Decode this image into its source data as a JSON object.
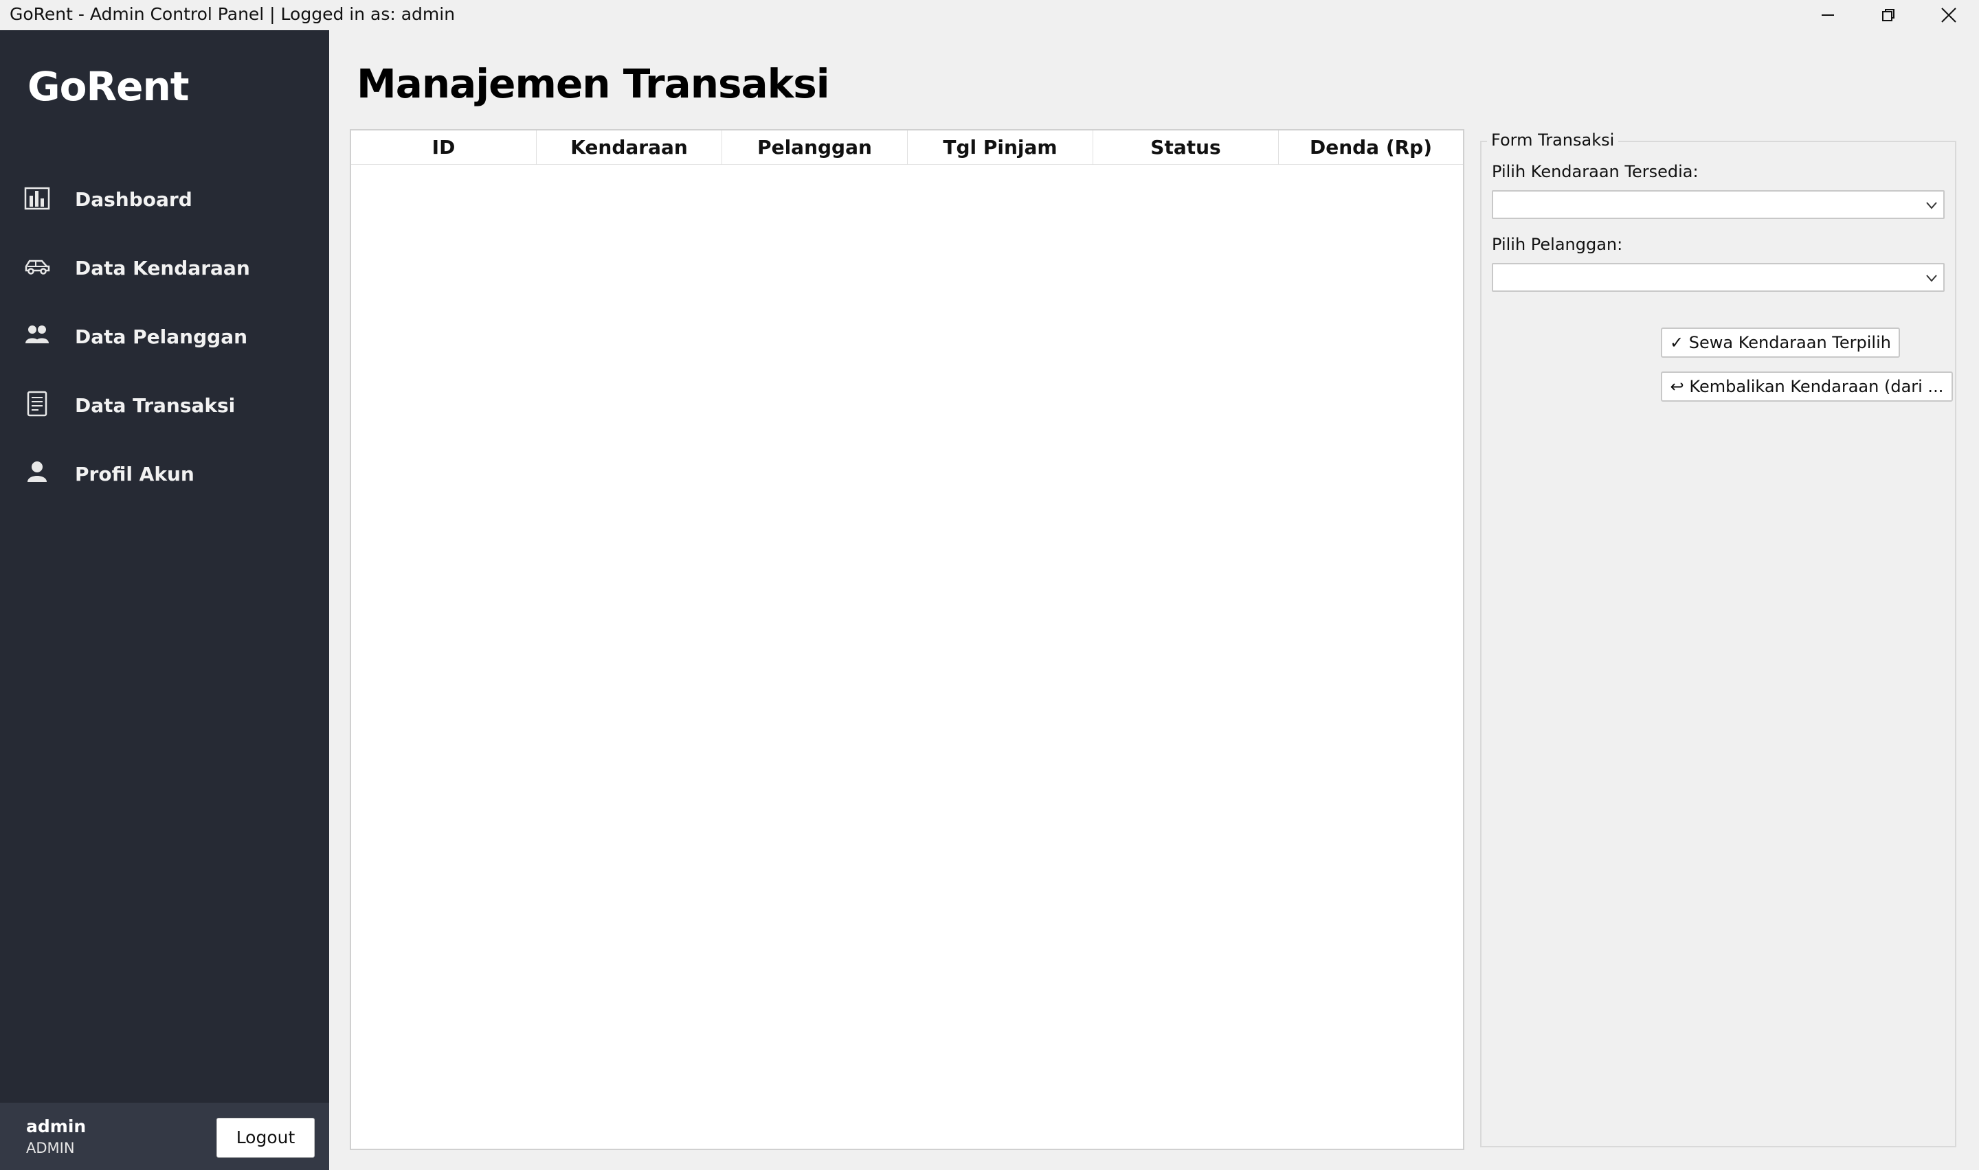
{
  "window": {
    "title": "GoRent - Admin Control Panel | Logged in as: admin"
  },
  "sidebar": {
    "brand": "GoRent",
    "items": [
      {
        "label": "Dashboard",
        "icon": "bar-chart-icon"
      },
      {
        "label": "Data Kendaraan",
        "icon": "car-icon"
      },
      {
        "label": "Data Pelanggan",
        "icon": "users-icon"
      },
      {
        "label": "Data Transaksi",
        "icon": "receipt-icon"
      },
      {
        "label": "Profil Akun",
        "icon": "user-icon"
      }
    ],
    "user": {
      "name": "admin",
      "role": "ADMIN",
      "logout_label": "Logout"
    }
  },
  "main": {
    "title": "Manajemen Transaksi",
    "table": {
      "columns": [
        "ID",
        "Kendaraan",
        "Pelanggan",
        "Tgl Pinjam",
        "Status",
        "Denda (Rp)"
      ],
      "rows": []
    }
  },
  "form": {
    "legend": "Form Transaksi",
    "vehicle_label": "Pilih Kendaraan Tersedia:",
    "vehicle_value": "",
    "customer_label": "Pilih Pelanggan:",
    "customer_value": "",
    "rent_button": "✓ Sewa Kendaraan Terpilih",
    "return_button": "↩ Kembalikan Kendaraan (dari ..."
  },
  "colors": {
    "sidebar_bg": "#262a34",
    "sidebar_footer_bg": "#343945",
    "page_bg": "#f0f0f0"
  }
}
